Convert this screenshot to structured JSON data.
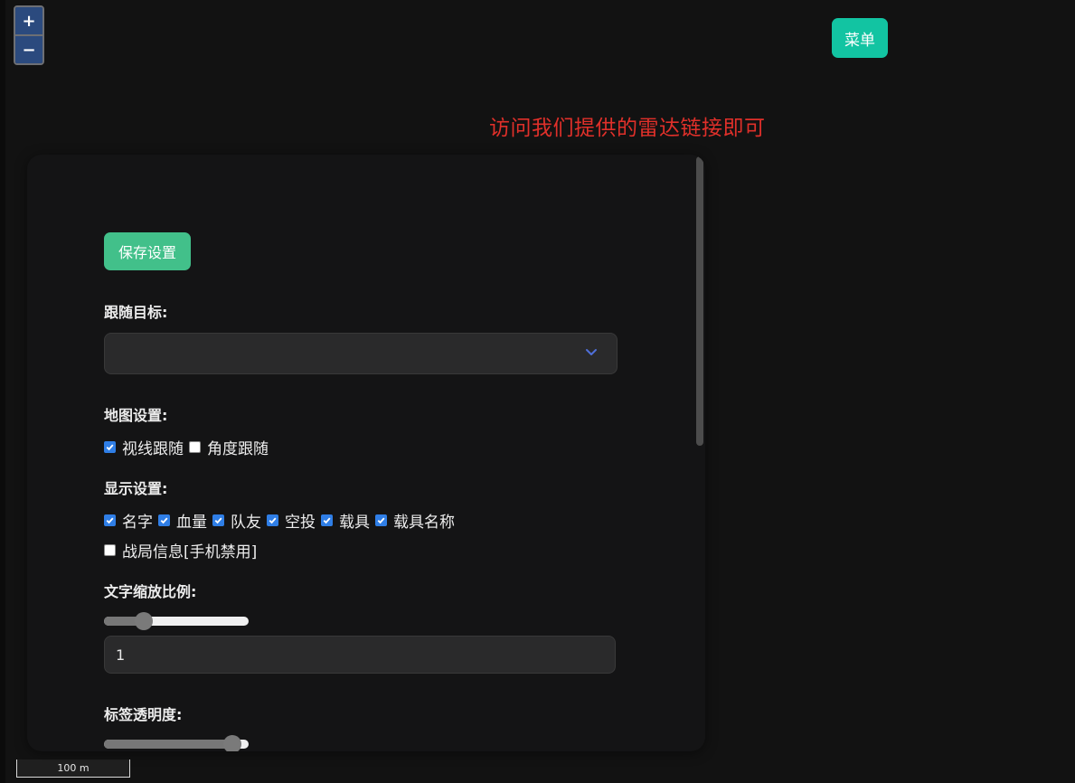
{
  "map": {
    "zoom_in": "+",
    "zoom_out": "−",
    "scale_label": "100 m"
  },
  "header": {
    "menu_label": "菜单",
    "notice": "访问我们提供的雷达链接即可"
  },
  "settings": {
    "save_label": "保存设置",
    "follow_target": {
      "label": "跟随目标:",
      "value": ""
    },
    "map_settings": {
      "label": "地图设置:",
      "options": [
        {
          "label": "视线跟随",
          "checked": true
        },
        {
          "label": "角度跟随",
          "checked": false
        }
      ]
    },
    "display_settings": {
      "label": "显示设置:",
      "options": [
        {
          "label": "名字",
          "checked": true
        },
        {
          "label": "血量",
          "checked": true
        },
        {
          "label": "队友",
          "checked": true
        },
        {
          "label": "空投",
          "checked": true
        },
        {
          "label": "载具",
          "checked": true
        },
        {
          "label": "载具名称",
          "checked": true
        },
        {
          "label": "战局信息[手机禁用]",
          "checked": false
        }
      ]
    },
    "text_scale": {
      "label": "文字缩放比例:",
      "slider_fraction": 0.24,
      "value": "1"
    },
    "label_opacity": {
      "label": "标签透明度:",
      "slider_fraction": 0.94
    }
  },
  "colors": {
    "menu_button": "#12c4a2",
    "save_button": "#42c08a",
    "notice_text": "#e0302a",
    "checkbox_checked": "#2f7ee6",
    "chevron": "#4f6fd8"
  }
}
